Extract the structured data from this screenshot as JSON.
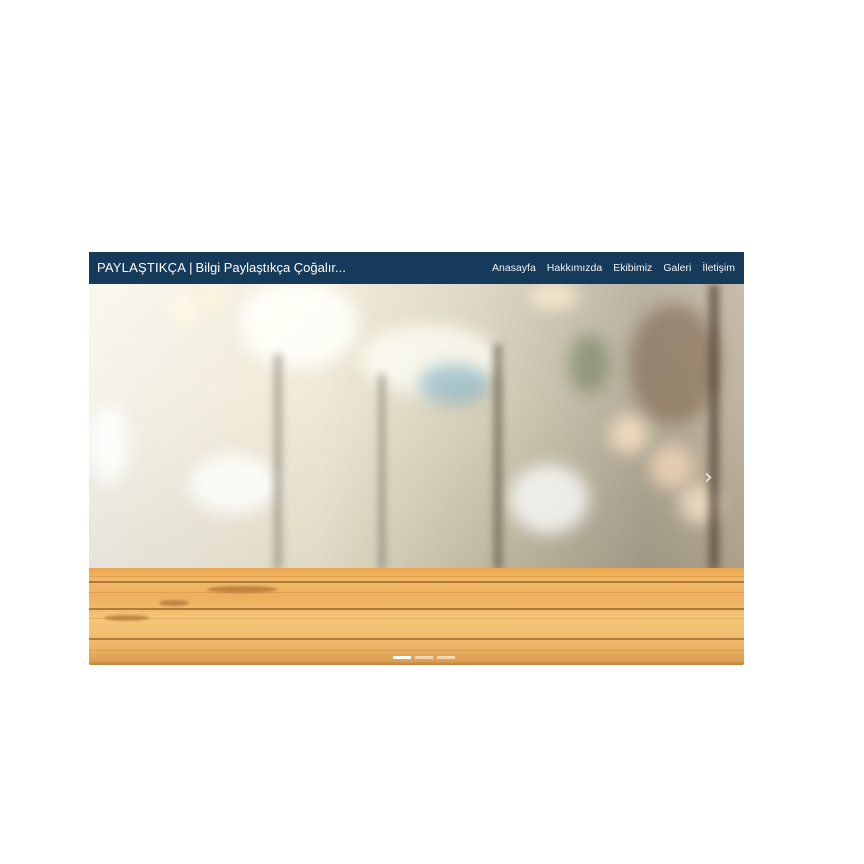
{
  "navbar": {
    "brand_strong": "PAYLAŞTIKÇA",
    "brand_separator": "|",
    "brand_tagline": "Bilgi Paylaştıkça Çoğalır...",
    "links": [
      {
        "label": "Anasayfa"
      },
      {
        "label": "Hakkımızda"
      },
      {
        "label": "Ekibimiz"
      },
      {
        "label": "Galeri"
      },
      {
        "label": "İletişim"
      }
    ],
    "background_color": "#163a5a"
  },
  "carousel": {
    "next_icon": "chevron-right-icon",
    "slide_count": 3,
    "active_slide": 1
  }
}
